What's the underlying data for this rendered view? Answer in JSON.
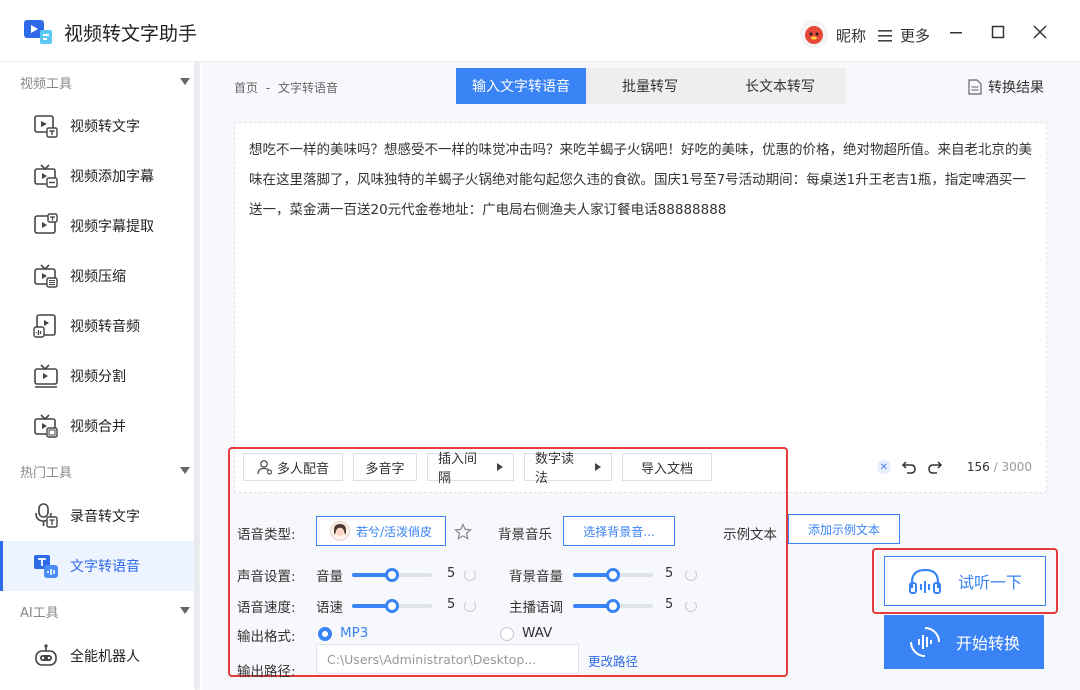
{
  "app": {
    "title": "视频转文字助手",
    "nickname": "昵称",
    "more": "更多"
  },
  "sidebar": {
    "groups": [
      {
        "label": "视频工具"
      },
      {
        "label": "热门工具"
      },
      {
        "label": "AI工具"
      }
    ],
    "items": [
      {
        "label": "视频转文字"
      },
      {
        "label": "视频添加字幕"
      },
      {
        "label": "视频字幕提取"
      },
      {
        "label": "视频压缩"
      },
      {
        "label": "视频转音频"
      },
      {
        "label": "视频分割"
      },
      {
        "label": "视频合并"
      },
      {
        "label": "录音转文字"
      },
      {
        "label": "文字转语音"
      },
      {
        "label": "全能机器人"
      }
    ],
    "active": "文字转语音"
  },
  "breadcrumb": {
    "home": "首页",
    "sep": "-",
    "current": "文字转语音"
  },
  "tabs": [
    {
      "label": "输入文字转语音"
    },
    {
      "label": "批量转写"
    },
    {
      "label": "长文本转写"
    }
  ],
  "result_link": "转换结果",
  "editor": {
    "text": "想吃不一样的美味吗？想感受不一样的味觉冲击吗？来吃羊蝎子火锅吧！好吃的美味，优惠的价格，绝对物超所值。来自老北京的美味在这里落脚了，风味独特的羊蝎子火锅绝对能勾起您久违的食欲。国庆1号至7号活动期间：每桌送1升王老吉1瓶，指定啤酒买一送一，菜金满一百送20元代金卷地址：广电局右侧渔夫人家订餐电话88888888",
    "count": "156",
    "max": "3000",
    "count_sep": "/"
  },
  "toolbar": {
    "multi_voice": "多人配音",
    "polyphone": "多音字",
    "insert_pause": "插入间隔",
    "number_read": "数字读法",
    "import_doc": "导入文档"
  },
  "settings": {
    "voice_type_label": "语音类型:",
    "voice_name": "若兮/活泼俏皮",
    "bgm_label": "背景音乐",
    "bgm_button": "选择背景音...",
    "sample_label": "示例文本",
    "sample_button": "添加示例文本",
    "sound_label": "声音设置:",
    "volume_label": "音量",
    "volume_value": "5",
    "volume_level": 0.5,
    "bg_volume_label": "背景音量",
    "bg_volume_value": "5",
    "bg_volume_level": 0.5,
    "speed_label": "语音速度:",
    "speed_sub": "语速",
    "speed_value": "5",
    "speed_level": 0.5,
    "tone_label": "主播语调",
    "tone_value": "5",
    "tone_level": 0.5,
    "format_label": "输出格式:",
    "format_mp3": "MP3",
    "format_wav": "WAV",
    "format_selected": "MP3",
    "path_label": "输出路径:",
    "path_value": "C:\\Users\\Administrator\\Desktop...",
    "change_path": "更改路径"
  },
  "actions": {
    "try_listen": "试听一下",
    "start": "开始转换"
  },
  "colors": {
    "accent": "#3a83f4",
    "highlight": "#e53b3b"
  }
}
